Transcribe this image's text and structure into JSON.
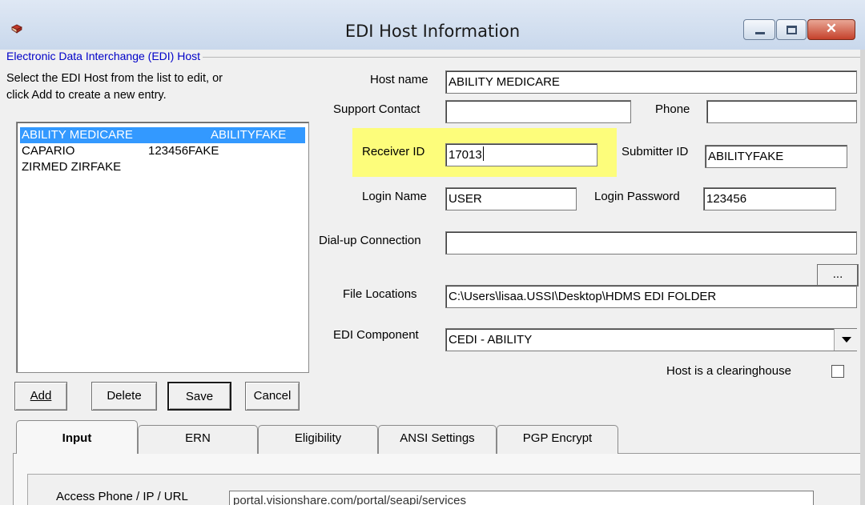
{
  "window": {
    "title": "EDI Host Information",
    "icon": "book-icon"
  },
  "group": {
    "title": "Electronic Data Interchange (EDI) Host",
    "instructions_line1": "Select the EDI Host from the list to edit, or",
    "instructions_line2": "click Add to create a new entry."
  },
  "hosts": [
    {
      "name": "ABILITY MEDICARE",
      "submitter": "ABILITYFAKE",
      "selected": true
    },
    {
      "name": "CAPARIO",
      "submitter": "123456FAKE",
      "selected": false
    },
    {
      "name": "ZIRMED ZIRFAKE",
      "submitter": "",
      "selected": false
    }
  ],
  "buttons": {
    "add": "Add",
    "delete": "Delete",
    "save": "Save",
    "cancel": "Cancel",
    "browse": "..."
  },
  "form": {
    "host_name_label": "Host name",
    "host_name": "ABILITY MEDICARE",
    "support_contact_label": "Support Contact",
    "support_contact": "",
    "phone_label": "Phone",
    "phone": "",
    "receiver_id_label": "Receiver ID",
    "receiver_id": "17013",
    "submitter_id_label": "Submitter ID",
    "submitter_id": "ABILITYFAKE",
    "login_name_label": "Login Name",
    "login_name": "USER",
    "login_password_label": "Login Password",
    "login_password": "123456",
    "dialup_label": "Dial-up Connection",
    "dialup": "",
    "file_locations_label": "File Locations",
    "file_locations": "C:\\Users\\lisaa.USSI\\Desktop\\HDMS EDI FOLDER",
    "edi_component_label": "EDI Component",
    "edi_component": "CEDI - ABILITY",
    "clearinghouse_label": "Host is a clearinghouse",
    "clearinghouse_checked": false
  },
  "tabs": [
    "Input",
    "ERN",
    "Eligibility",
    "ANSI Settings",
    "PGP Encrypt"
  ],
  "active_tab": "Input",
  "input_tab": {
    "access_label": "Access Phone / IP / URL",
    "access_value": "portal.visionshare.com/portal/seapi/services"
  },
  "colors": {
    "highlight": "#ffff66",
    "selection": "#3399ff",
    "group_title": "#0000c8"
  }
}
